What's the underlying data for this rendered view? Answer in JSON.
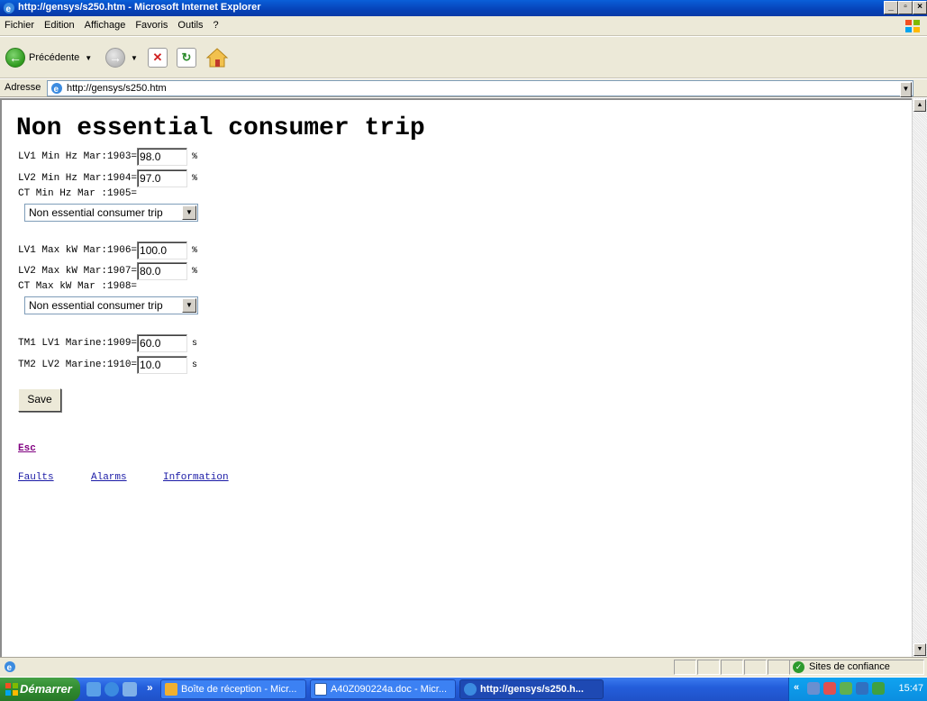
{
  "window": {
    "title": "http://gensys/s250.htm - Microsoft Internet Explorer",
    "buttons": [
      "_",
      "×"
    ]
  },
  "menu": [
    "Fichier",
    "Edition",
    "Affichage",
    "Favoris",
    "Outils",
    "?"
  ],
  "toolbar": {
    "back_label": "Précédente"
  },
  "address": {
    "label": "Adresse",
    "url": "http://gensys/s250.htm"
  },
  "page": {
    "title": "Non essential consumer trip",
    "fields": [
      {
        "label": "LV1 Min Hz Mar:1903=",
        "value": "98.0",
        "unit": "%"
      },
      {
        "label": "LV2 Min Hz Mar:1904=",
        "value": "97.0",
        "unit": "%"
      },
      {
        "label": "CT Min Hz Mar :1905="
      },
      {
        "label": "LV1 Max kW Mar:1906=",
        "value": "100.0",
        "unit": "%"
      },
      {
        "label": "LV2 Max kW Mar:1907=",
        "value": "80.0",
        "unit": "%"
      },
      {
        "label": "CT Max kW Mar :1908="
      },
      {
        "label": "TM1 LV1 Marine:1909=",
        "value": "60.0",
        "unit": "s"
      },
      {
        "label": "TM2 LV2 Marine:1910=",
        "value": "10.0",
        "unit": "s"
      }
    ],
    "selects": [
      "Non essential consumer trip",
      "Non essential consumer trip"
    ],
    "save_label": "Save",
    "esc_label": "Esc",
    "links": [
      "Faults",
      "Alarms",
      "Information"
    ]
  },
  "status": {
    "zone": "Sites de confiance"
  },
  "taskbar": {
    "start": "Démarrer",
    "more": "»",
    "tasks": [
      "Boîte de réception - Micr...",
      "A40Z090224a.doc - Micr...",
      "http://gensys/s250.h..."
    ],
    "tray_chevron": "«",
    "clock": "15:47"
  },
  "colors": {
    "titlebar": "#0a5fd8",
    "link": "#1a1aa6",
    "visited_link": "#800080",
    "chrome": "#ece9d8"
  }
}
